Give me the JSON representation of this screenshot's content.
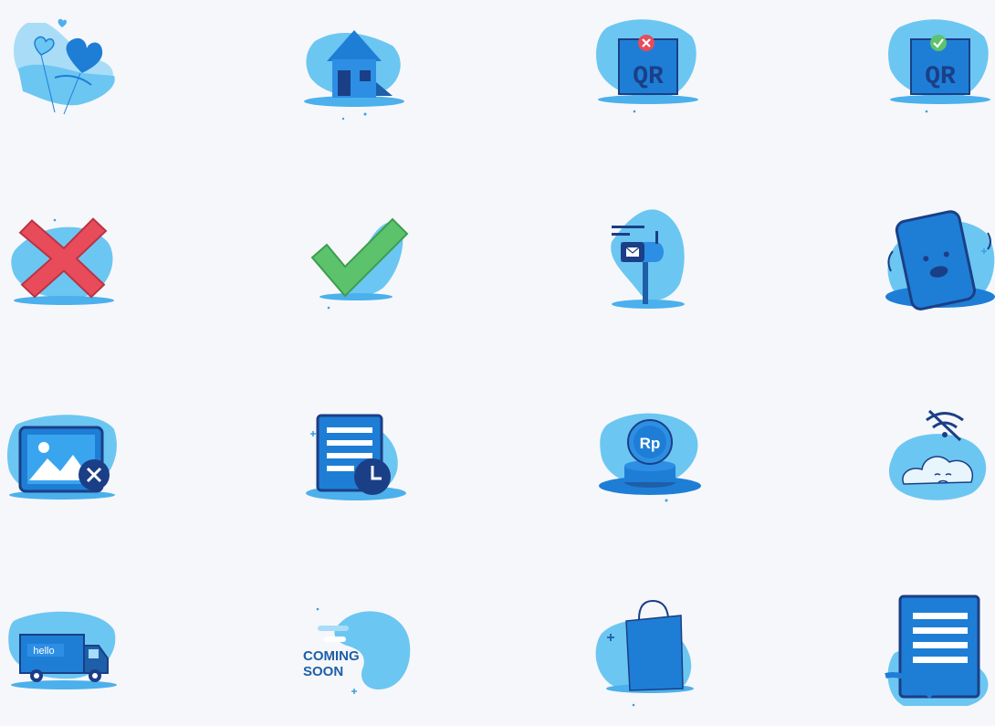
{
  "colors": {
    "background": "#f6f7fa",
    "blob": "#6cc6f2",
    "blob_light": "#a9ddf7",
    "primary": "#1e7ed6",
    "dark": "#1d5fa8",
    "navy": "#1b3f86",
    "danger": "#e84b5a",
    "success": "#5cc36c"
  },
  "icons": [
    {
      "name": "heart-hand-icon"
    },
    {
      "name": "house-icon"
    },
    {
      "name": "qr-error-icon",
      "text": "QR"
    },
    {
      "name": "qr-success-icon",
      "text": "QR"
    },
    {
      "name": "red-cross-icon"
    },
    {
      "name": "green-check-icon"
    },
    {
      "name": "mailbox-icon"
    },
    {
      "name": "sad-phone-icon"
    },
    {
      "name": "broken-image-icon"
    },
    {
      "name": "document-clock-icon"
    },
    {
      "name": "rupiah-coins-icon",
      "text": "Rp"
    },
    {
      "name": "no-wifi-cloud-icon"
    },
    {
      "name": "delivery-truck-icon",
      "text": "hello"
    },
    {
      "name": "coming-soon-icon",
      "text_line1": "COMING",
      "text_line2": "SOON"
    },
    {
      "name": "shopping-bag-icon"
    },
    {
      "name": "document-list-icon"
    }
  ]
}
